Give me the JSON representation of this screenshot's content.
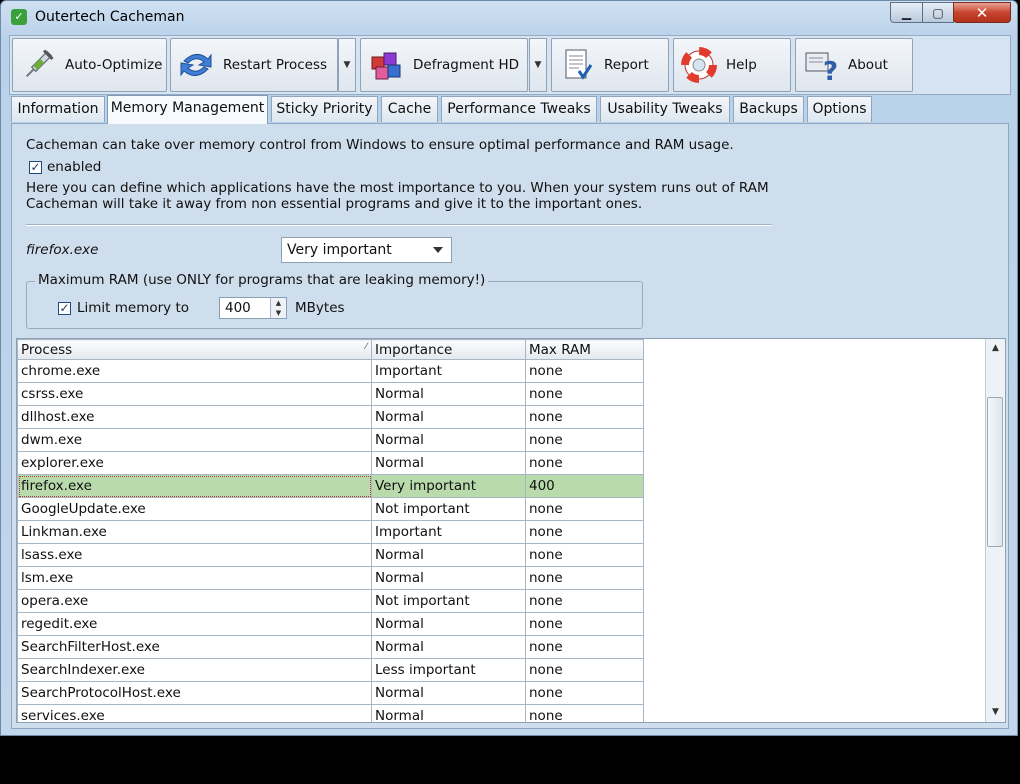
{
  "window": {
    "title": "Outertech Cacheman",
    "min": "▁",
    "max": "▢",
    "close": "✕"
  },
  "toolbar": {
    "buttons": [
      {
        "label": "Auto-Optimize",
        "icon": "syringe-icon"
      },
      {
        "label": "Restart Process",
        "icon": "arrows-icon"
      },
      {
        "label": "Defragment HD",
        "icon": "blocks-icon"
      },
      {
        "label": "Report",
        "icon": "document-icon"
      },
      {
        "label": "Help",
        "icon": "lifebuoy-icon"
      },
      {
        "label": "About",
        "icon": "about-icon"
      }
    ],
    "dropdown_arrow": "▼"
  },
  "tabs": [
    "Information",
    "Memory Management",
    "Sticky Priority",
    "Cache",
    "Performance Tweaks",
    "Usability Tweaks",
    "Backups",
    "Options"
  ],
  "active_tab": "Memory Management",
  "memory": {
    "intro": "Cacheman can take over memory control from Windows to ensure optimal performance and RAM usage.",
    "enabled_label": "enabled",
    "enabled_check": "✓",
    "explain1": "Here you can define which applications have the most importance to you. When your system runs out of RAM",
    "explain2": "Cacheman will take it away from non essential programs and give it to the important ones.",
    "selected_process": "firefox.exe",
    "importance_value": "Very important",
    "max_ram_group": "Maximum RAM (use ONLY for programs that are leaking memory!)",
    "limit_label": "Limit memory to",
    "limit_check": "✓",
    "limit_value": "400",
    "limit_unit": "MBytes"
  },
  "table": {
    "headers": [
      "Process",
      "Importance",
      "Max RAM"
    ],
    "sort_glyph": "⁄",
    "rows": [
      [
        "chrome.exe",
        "Important",
        "none"
      ],
      [
        "csrss.exe",
        "Normal",
        "none"
      ],
      [
        "dllhost.exe",
        "Normal",
        "none"
      ],
      [
        "dwm.exe",
        "Normal",
        "none"
      ],
      [
        "explorer.exe",
        "Normal",
        "none"
      ],
      [
        "firefox.exe",
        "Very important",
        "400"
      ],
      [
        "GoogleUpdate.exe",
        "Not important",
        "none"
      ],
      [
        "Linkman.exe",
        "Important",
        "none"
      ],
      [
        "lsass.exe",
        "Normal",
        "none"
      ],
      [
        "lsm.exe",
        "Normal",
        "none"
      ],
      [
        "opera.exe",
        "Not important",
        "none"
      ],
      [
        "regedit.exe",
        "Normal",
        "none"
      ],
      [
        "SearchFilterHost.exe",
        "Normal",
        "none"
      ],
      [
        "SearchIndexer.exe",
        "Less important",
        "none"
      ],
      [
        "SearchProtocolHost.exe",
        "Normal",
        "none"
      ],
      [
        "services.exe",
        "Normal",
        "none"
      ]
    ],
    "selected_row": "firefox.exe"
  },
  "colors": {
    "selected_row": "#b9dbac",
    "close_button": "#c7452f"
  }
}
